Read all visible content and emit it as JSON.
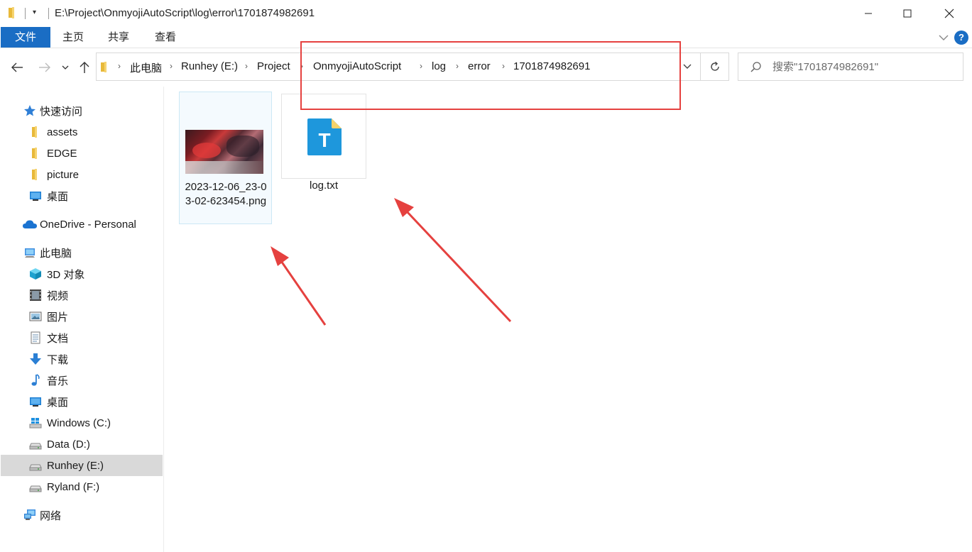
{
  "titlebar": {
    "path": "E:\\Project\\OnmyojiAutoScript\\log\\error\\1701874982691",
    "dropdown_glyph": "▾"
  },
  "ribbon": {
    "tabs": [
      "文件",
      "主页",
      "共享",
      "查看"
    ],
    "help_label": "?"
  },
  "address": {
    "crumbs": [
      "此电脑",
      "Runhey (E:)",
      "Project",
      "OnmyojiAutoScript",
      "log",
      "error",
      "1701874982691"
    ]
  },
  "search": {
    "placeholder": "搜索\"1701874982691\""
  },
  "sidebar": {
    "items": [
      {
        "label": "快速访问",
        "icon": "star-icon"
      },
      {
        "label": "assets",
        "icon": "folder-icon"
      },
      {
        "label": "EDGE",
        "icon": "folder-icon"
      },
      {
        "label": "picture",
        "icon": "folder-icon"
      },
      {
        "label": "桌面",
        "icon": "desktop-icon"
      },
      {
        "label": "OneDrive - Personal",
        "icon": "cloud-icon"
      },
      {
        "label": "此电脑",
        "icon": "computer-icon"
      },
      {
        "label": "3D 对象",
        "icon": "cube-icon"
      },
      {
        "label": "视频",
        "icon": "video-icon"
      },
      {
        "label": "图片",
        "icon": "picture-icon"
      },
      {
        "label": "文档",
        "icon": "document-icon"
      },
      {
        "label": "下载",
        "icon": "download-icon"
      },
      {
        "label": "音乐",
        "icon": "music-icon"
      },
      {
        "label": "桌面",
        "icon": "desktop-icon"
      },
      {
        "label": "Windows (C:)",
        "icon": "windows-drive-icon"
      },
      {
        "label": "Data (D:)",
        "icon": "drive-icon"
      },
      {
        "label": "Runhey (E:)",
        "icon": "drive-icon",
        "selected": true
      },
      {
        "label": "Ryland (F:)",
        "icon": "drive-icon"
      },
      {
        "label": "网络",
        "icon": "network-icon"
      }
    ]
  },
  "files": [
    {
      "name": "2023-12-06_23-03-02-623454.png",
      "type": "image",
      "selected": true
    },
    {
      "name": "log.txt",
      "type": "text",
      "icon_letter": "T"
    }
  ],
  "colors": {
    "accent": "#1a6dc4",
    "annotation": "#e5413f",
    "selected_bg": "#d9d9d9",
    "txt_icon": "#1e97dc"
  }
}
